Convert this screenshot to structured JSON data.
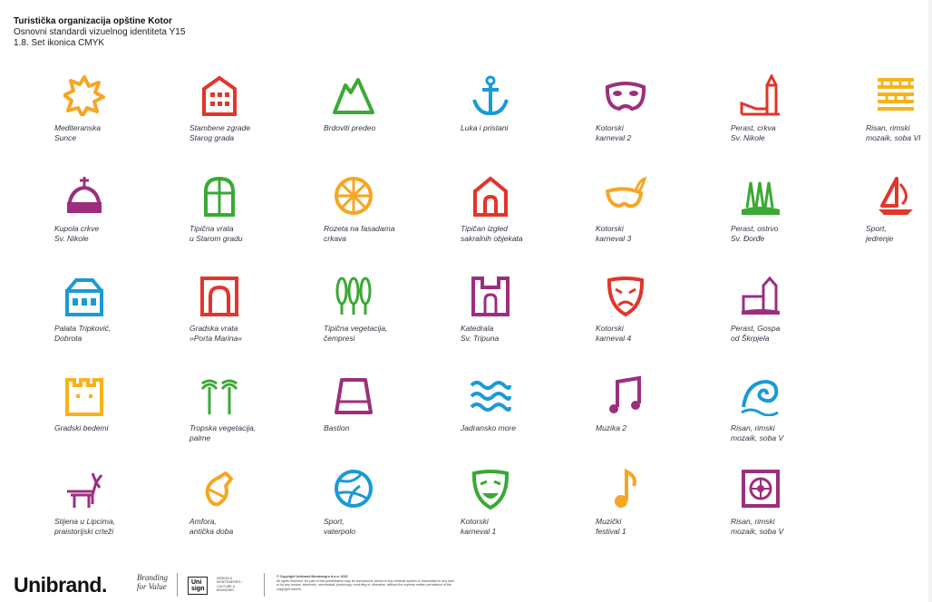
{
  "header": {
    "title": "Turistička organizacija opštine Kotor",
    "subtitle": "Osnovni standardi vizuelnog identiteta Y15",
    "section": "1.8. Set ikonica CMYK"
  },
  "colors": {
    "orange": "#f5a623",
    "red": "#e2352b",
    "green": "#3aa935",
    "blue": "#1a9ad6",
    "purple": "#9c2f7d",
    "yellow": "#f9b218"
  },
  "icons": [
    {
      "icon": "sun-icon",
      "color": "#f5a623",
      "label": "Mediteranska\nSunce"
    },
    {
      "icon": "old-town-building-icon",
      "color": "#e2352b",
      "label": "Stambene zgrade\nStarog grada"
    },
    {
      "icon": "mountains-icon",
      "color": "#3aa935",
      "label": "Brdoviti predeo"
    },
    {
      "icon": "anchor-icon",
      "color": "#1a9ad6",
      "label": "Luka i pristani"
    },
    {
      "icon": "carnival-mask-icon",
      "color": "#9c2f7d",
      "label": "Kotorski\nkarneval 2"
    },
    {
      "icon": "church-tower-icon",
      "color": "#e2352b",
      "label": "Perast, crkva\nSv. Nikole"
    },
    {
      "icon": "mosaic-pattern-icon",
      "color": "#f9b218",
      "label": "Risan, rimski\nmozaik, soba VI"
    },
    {
      "icon": "church-dome-icon",
      "color": "#9c2f7d",
      "label": "Kupola crkve\nSv. Nikole"
    },
    {
      "icon": "door-icon",
      "color": "#3aa935",
      "label": "Tipična vrata\nu Starom gradu"
    },
    {
      "icon": "rosette-icon",
      "color": "#f5a623",
      "label": "Rozeta na fasadama\ncrkava"
    },
    {
      "icon": "chapel-icon",
      "color": "#e2352b",
      "label": "Tipičan izgled\nsakralnih objekata"
    },
    {
      "icon": "feather-mask-icon",
      "color": "#f5a623",
      "label": "Kotorski\nkarneval 3"
    },
    {
      "icon": "island-trees-icon",
      "color": "#3aa935",
      "label": "Perast, ostrvo\nSv. Đorđe"
    },
    {
      "icon": "sailboat-icon",
      "color": "#e2352b",
      "label": "Sport,\njedrenje"
    },
    {
      "icon": "palace-icon",
      "color": "#1a9ad6",
      "label": "Palata Tripković,\nDobrota"
    },
    {
      "icon": "city-gate-icon",
      "color": "#e2352b",
      "label": "Gradska vrata\n»Porta Marina«"
    },
    {
      "icon": "cypress-trees-icon",
      "color": "#3aa935",
      "label": "Tipična vegetacija,\nčempresi"
    },
    {
      "icon": "cathedral-icon",
      "color": "#9c2f7d",
      "label": "Katedrala\nSv. Tripuna"
    },
    {
      "icon": "tragedy-mask-icon",
      "color": "#e2352b",
      "label": "Kotorski\nkarneval 4"
    },
    {
      "icon": "island-church-icon",
      "color": "#9c2f7d",
      "label": "Perast, Gospa\nod Škrpjela"
    },
    {
      "icon": "city-wall-icon",
      "color": "#f9b218",
      "label": "Gradski bedemi"
    },
    {
      "icon": "palm-trees-icon",
      "color": "#3aa935",
      "label": "Tropska vegetacija,\npalme"
    },
    {
      "icon": "bastion-icon",
      "color": "#9c2f7d",
      "label": "Bastion"
    },
    {
      "icon": "waves-icon",
      "color": "#1a9ad6",
      "label": "Jadransko more"
    },
    {
      "icon": "music-notes-icon",
      "color": "#9c2f7d",
      "label": "Muzika 2"
    },
    {
      "icon": "wave-spiral-icon",
      "color": "#1a9ad6",
      "label": "Risan, rimski\nmozaik, soba V"
    },
    {
      "icon": "deer-icon",
      "color": "#9c2f7d",
      "label": "Stijena u Lipcima,\npraistorijski crteži"
    },
    {
      "icon": "amphora-icon",
      "color": "#f5a623",
      "label": "Amfora,\nantička doba"
    },
    {
      "icon": "water-polo-ball-icon",
      "color": "#1a9ad6",
      "label": "Sport,\nvaterpolo"
    },
    {
      "icon": "comedy-mask-icon",
      "color": "#3aa935",
      "label": "Kotorski\nkarneval 1"
    },
    {
      "icon": "music-note-icon",
      "color": "#f5a623",
      "label": "Muzički\nfestival 1"
    },
    {
      "icon": "mosaic-tile-icon",
      "color": "#9c2f7d",
      "label": "Risan, rimski\nmozaik, soba V"
    }
  ],
  "footer": {
    "brand": "Unibrand.",
    "tagline_1": "Branding",
    "tagline_2": "for Value",
    "unisign_1": "Uni",
    "unisign_2": "sign",
    "unisign_desc": "DESIGN & MONTENEGRO / CULTURE & BRANDING",
    "copyright": "© Copyright Unibrand Montenegro d.o.o. 2015",
    "legal": "All rights reserved. No part of this presentation may be reproduced, stored in any retrieval system or transmitted in any form or by any means, electronic, mechanical, photocopy, recording or otherwise, without the express written permission of the copyright owners."
  }
}
